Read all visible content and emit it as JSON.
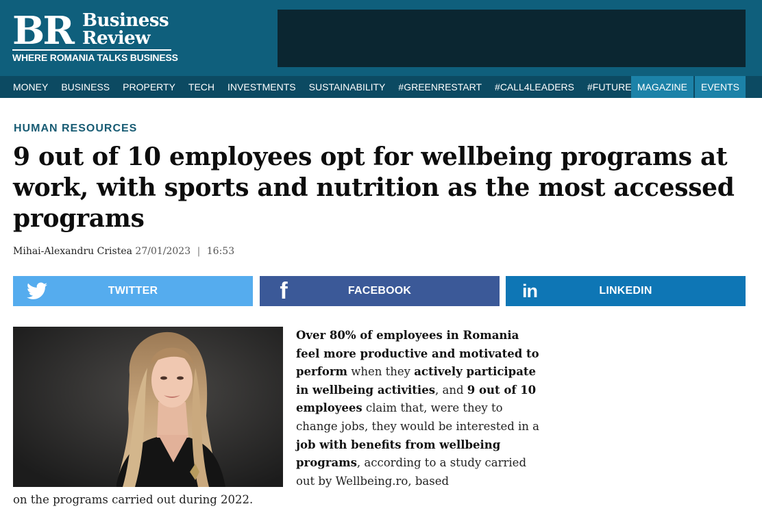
{
  "brand": {
    "monogram": "BR",
    "line1": "Business",
    "line2": "Review",
    "tagline": "WHERE ROMANIA TALKS BUSINESS"
  },
  "nav": {
    "items": [
      "MONEY",
      "BUSINESS",
      "PROPERTY",
      "TECH",
      "INVESTMENTS",
      "SUSTAINABILITY",
      "#GREENRESTART",
      "#CALL4LEADERS",
      "#FUTUREOFWORK"
    ],
    "buttons": [
      "MAGAZINE",
      "EVENTS"
    ]
  },
  "article": {
    "category": "HUMAN RESOURCES",
    "title": "9 out of 10 employees opt for wellbeing programs at work, with sports and nutrition as the most accessed programs",
    "author": "Mihai-Alexandru Cristea",
    "date": "27/01/2023",
    "separator": "|",
    "time": "16:53",
    "body": {
      "s1_bold": "Over 80% of employees in Romania feel more productive and motivated to perform",
      "s2": " when they ",
      "s3_bold": "actively participate in wellbeing activities",
      "s4": ", and ",
      "s5_bold": "9 out of 10 employees",
      "s6": " claim that, were they to change jobs, they would be interested in a ",
      "s7_bold": "job with benefits from wellbeing programs",
      "s8": ", according to a study carried out by Wellbeing.ro, based",
      "tail": "on the programs carried out during 2022."
    }
  },
  "share": {
    "twitter": "TWITTER",
    "facebook": "FACEBOOK",
    "linkedin": "LINKEDIN",
    "facebook_glyph": "f",
    "linkedin_glyph": "in"
  },
  "colors": {
    "header": "#0f5f7c",
    "nav": "#0c4a62",
    "nav_button": "#1c82a8",
    "category": "#175b73",
    "twitter": "#55acee",
    "facebook": "#3b5998",
    "linkedin": "#0e76b5"
  },
  "icons": [
    "twitter-bird-icon",
    "facebook-icon",
    "linkedin-icon"
  ]
}
